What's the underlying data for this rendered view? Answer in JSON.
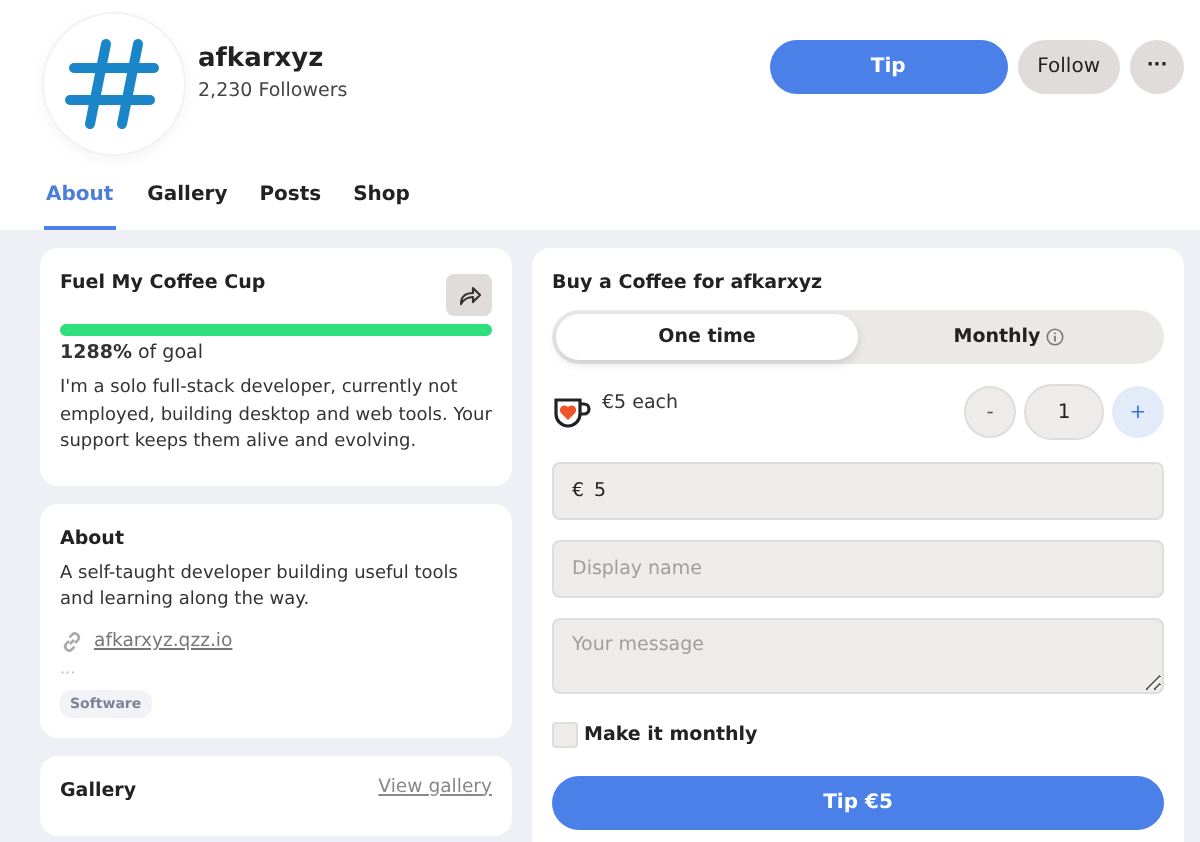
{
  "profile": {
    "name": "afkarxyz",
    "followers": "2,230 Followers"
  },
  "header_buttons": {
    "tip": "Tip",
    "follow": "Follow",
    "more": "···"
  },
  "tabs": [
    {
      "label": "About",
      "selected": true
    },
    {
      "label": "Gallery",
      "selected": false
    },
    {
      "label": "Posts",
      "selected": false
    },
    {
      "label": "Shop",
      "selected": false
    }
  ],
  "goal_card": {
    "title": "Fuel My Coffee Cup",
    "level": 1,
    "progress_text": "**1288%** of goal",
    "description": "I'm a solo full-stack developer, currently not employed, building desktop and web tools. Your support keeps them alive and evolving."
  },
  "about_card": {
    "title": "About",
    "bio": "A self-taught developer building useful tools and learning along the way.",
    "link": "afkarxyz.qzz.io",
    "more": "···",
    "tags": [
      "Software"
    ]
  },
  "gallery_card": {
    "title": "Gallery",
    "link": "View gallery"
  },
  "tip_form": {
    "title": "Buy a Coffee for afkarxyz",
    "frequency": [
      {
        "label": "One time",
        "selected": true,
        "info": false
      },
      {
        "label": "Monthly",
        "selected": false,
        "info": true
      }
    ],
    "unit_price": "€5 each",
    "minus": "-",
    "quantity": "1",
    "plus": "+",
    "currency": "€",
    "amount": "5",
    "name_placeholder": "Display name",
    "message_placeholder": "Your message",
    "monthly_checkbox": {
      "label": "Make it monthly",
      "checked": false
    },
    "submit": "Tip €5"
  }
}
